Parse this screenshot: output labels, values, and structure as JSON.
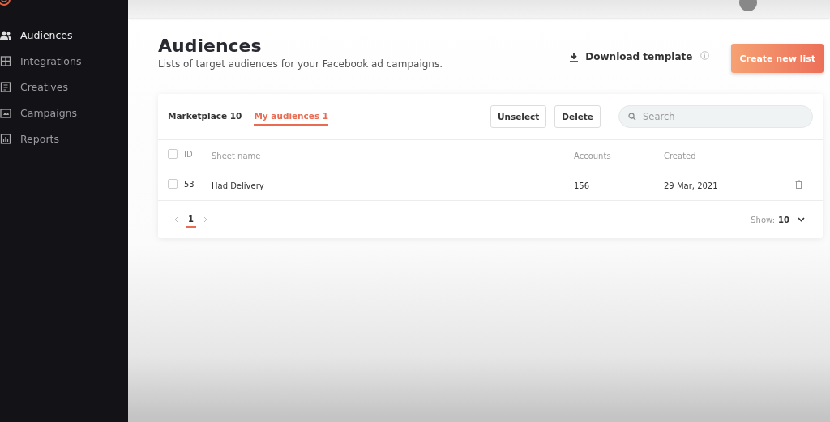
{
  "sidebar": {
    "items": [
      {
        "label": "Audiences",
        "selected": true
      },
      {
        "label": "Integrations",
        "selected": false
      },
      {
        "label": "Creatives",
        "selected": false
      },
      {
        "label": "Campaigns",
        "selected": false
      },
      {
        "label": "Reports",
        "selected": false
      }
    ]
  },
  "header": {
    "title": "Audiences",
    "subtitle": "Lists of target audiences for your Facebook ad campaigns.",
    "download": "Download template",
    "create": "Create new list"
  },
  "card": {
    "tabs": [
      {
        "label": "Marketplace 10",
        "selected": false
      },
      {
        "label": "My audiences 1",
        "selected": true
      }
    ],
    "buttons": [
      "Unselect",
      "Delete"
    ],
    "search": {
      "placeholder": "Search"
    },
    "table": {
      "columns": [
        "ID",
        "Sheet name",
        "Accounts",
        "Created"
      ],
      "rows": [
        {
          "checked": false,
          "cells": [
            "53",
            "Had Delivery",
            "156",
            "29 Mar, 2021"
          ]
        }
      ]
    },
    "header_checked": false,
    "pagination": {
      "pages": [
        {
          "label": "1",
          "selected": true
        }
      ]
    },
    "show": {
      "label": "Show:",
      "value": "10"
    }
  }
}
